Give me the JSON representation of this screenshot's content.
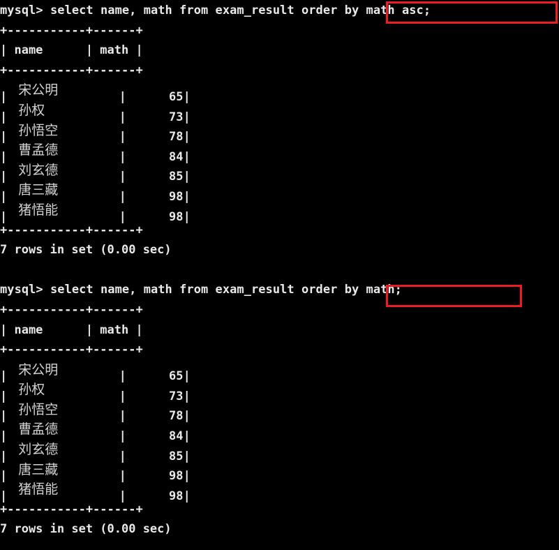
{
  "terminal": {
    "background_color": "#000000",
    "text_color": "#e9e9e9",
    "cjk_text_color": "#d2d2d2",
    "highlight_color": "#ec1c24"
  },
  "table": {
    "separator": "+-----------+------+",
    "header_row": "| name      | math |",
    "columns": [
      "name",
      "math"
    ],
    "rows": [
      {
        "name": "宋公明",
        "math": "65"
      },
      {
        "name": "孙权",
        "math": "73"
      },
      {
        "name": "孙悟空",
        "math": "78"
      },
      {
        "name": "曹孟德",
        "math": "84"
      },
      {
        "name": "刘玄德",
        "math": "85"
      },
      {
        "name": "唐三藏",
        "math": "98"
      },
      {
        "name": "猪悟能",
        "math": "98"
      }
    ]
  },
  "blocks": [
    {
      "prompt": "mysql> ",
      "query_prefix": "select name, math from exam_result ",
      "query_highlighted": "order by math asc;",
      "result_status": "7 rows in set (0.00 sec)"
    },
    {
      "prompt": "mysql> ",
      "query_prefix": "select name, math from exam_result ",
      "query_highlighted": "order by math;",
      "result_status": "7 rows in set (0.00 sec)"
    }
  ],
  "glyphs": {
    "pipe": "|",
    "plus": "+",
    "pad_left": " ",
    "pad_cell": "      "
  }
}
